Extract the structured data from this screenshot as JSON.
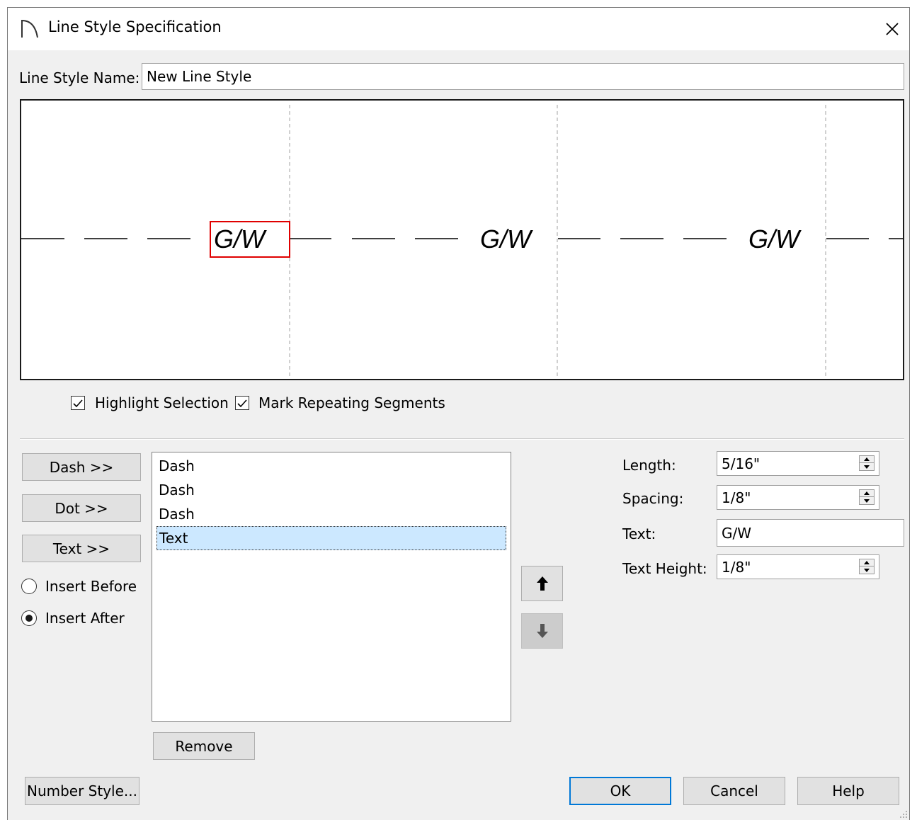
{
  "window": {
    "title": "Line Style Specification"
  },
  "name_field": {
    "label": "Line Style Name:",
    "value": "New Line Style"
  },
  "preview": {
    "segment_text": "G/W"
  },
  "options": {
    "highlight_selection": {
      "label": "Highlight Selection",
      "checked": true
    },
    "mark_repeating": {
      "label": "Mark Repeating Segments",
      "checked": true
    }
  },
  "add_buttons": {
    "dash": "Dash >>",
    "dot": "Dot >>",
    "text": "Text >>"
  },
  "insert_mode": {
    "before": "Insert Before",
    "after": "Insert After",
    "selected": "after"
  },
  "segments": [
    "Dash",
    "Dash",
    "Dash",
    "Text"
  ],
  "selected_segment": 3,
  "remove_label": "Remove",
  "properties": {
    "length": {
      "label": "Length:",
      "value": "5/16\""
    },
    "spacing": {
      "label": "Spacing:",
      "value": "1/8\""
    },
    "text": {
      "label": "Text:",
      "value": "G/W"
    },
    "text_height": {
      "label": "Text Height:",
      "value": "1/8\""
    }
  },
  "footer": {
    "number_style": "Number Style...",
    "ok": "OK",
    "cancel": "Cancel",
    "help": "Help"
  },
  "colors": {
    "selection_box": "#e00000",
    "list_selection": "#cce8ff",
    "default_button_border": "#0078d7"
  }
}
